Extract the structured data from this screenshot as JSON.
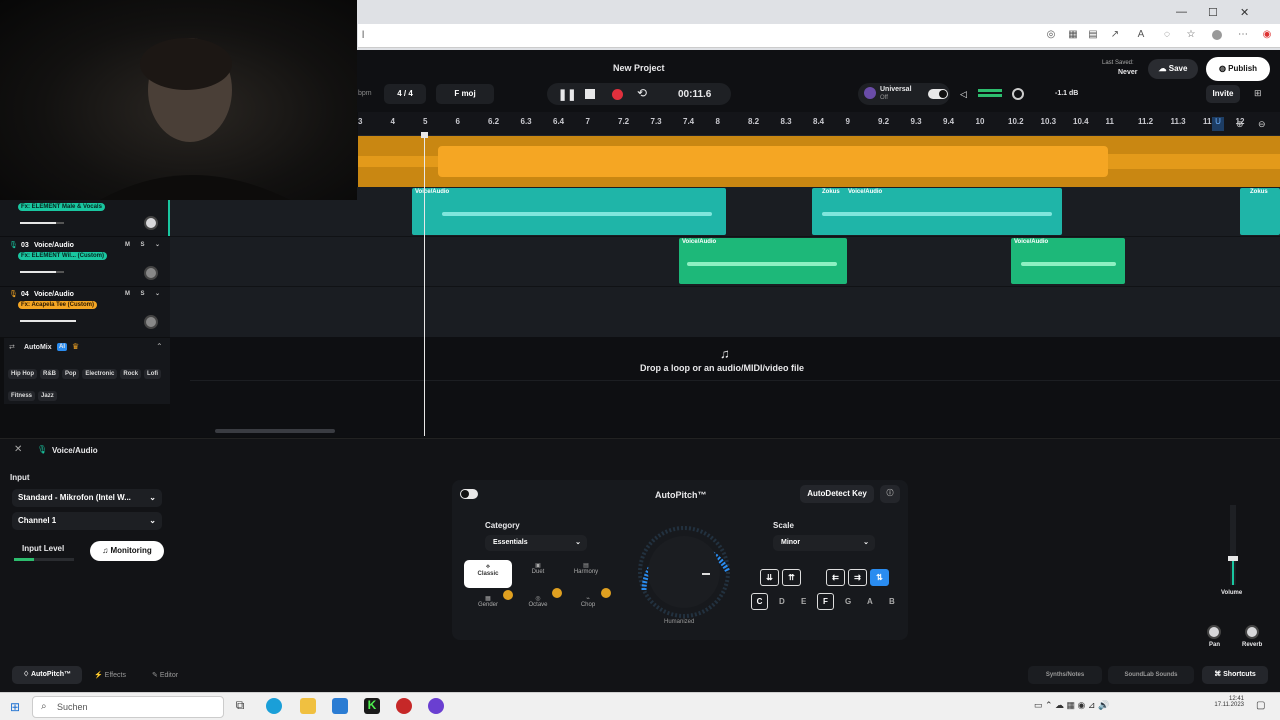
{
  "browser": {
    "address_fragment": "l",
    "icons": [
      "minimize-icon",
      "maximize-icon",
      "close-icon"
    ]
  },
  "header": {
    "project_title": "New Project",
    "last_saved_label": "Last Saved:",
    "last_saved_value": "Never",
    "save_label": "Save",
    "publish_label": "Publish",
    "invite_label": "Invite",
    "tempo_label": "bpm",
    "time_signature": "4 / 4",
    "key": "F moj",
    "time_display": "00:11.6",
    "universal_label": "Universal",
    "universal_sub": "Off",
    "db_readout": "-1.1 dB"
  },
  "ruler": {
    "ticks": [
      "3",
      "4",
      "5",
      "6",
      "6.2",
      "6.3",
      "6.4",
      "7",
      "7.2",
      "7.3",
      "7.4",
      "8",
      "8.2",
      "8.3",
      "8.4",
      "9",
      "9.2",
      "9.3",
      "9.4",
      "10",
      "10.2",
      "10.3",
      "10.4",
      "11",
      "11.2",
      "11.3",
      "11.4",
      "12"
    ]
  },
  "tracks": [
    {
      "number": "",
      "name": "",
      "tag": "Fx: ELEMENT Male & Vocals",
      "tag_color": "#19c6a0"
    },
    {
      "number": "03",
      "name": "Voice/Audio",
      "tag": "Fx: ELEMENT Wil... (Custom)",
      "tag_color": "#19c6a0"
    },
    {
      "number": "04",
      "name": "Voice/Audio",
      "tag": "Fx: Acapela Tee (Custom)",
      "tag_color": "#f5a623"
    }
  ],
  "clips": {
    "label": "Voice/Audio",
    "label_alt": "Zokus"
  },
  "automix": {
    "title": "AutoMix",
    "badge": "AI",
    "genres": [
      "Hip Hop",
      "R&B",
      "Pop",
      "Electronic",
      "Rock",
      "Lofi",
      "Fitness",
      "Jazz"
    ]
  },
  "dropzone": {
    "text": "Drop a loop or an audio/MIDI/video file"
  },
  "panel": {
    "track_name": "Voice/Audio",
    "input_title": "Input",
    "input_device": "Standard - Mikrofon (Intel W...",
    "channel": "Channel 1",
    "input_level_label": "Input Level",
    "monitoring_label": "Monitoring"
  },
  "autopitch": {
    "title": "AutoPitch™",
    "autodetect_label": "AutoDetect Key",
    "category_label": "Category",
    "category_value": "Essentials",
    "scale_label": "Scale",
    "scale_value": "Minor",
    "effects": [
      "Classic",
      "Duet",
      "Gender",
      "Harmony",
      "Chop",
      "Octave"
    ],
    "dial_label": "Humanized",
    "keys": [
      "C",
      "D",
      "E",
      "F",
      "G",
      "A",
      "B"
    ],
    "selected_keys": [
      "C",
      "F"
    ]
  },
  "mixer": {
    "volume_label": "Volume",
    "pan_label": "Pan",
    "reverb_label": "Reverb"
  },
  "footer": {
    "tab_autopitch": "AutoPitch™",
    "tab_effects": "Effects",
    "tab_editor": "Editor",
    "synths_label": "Synths/Notes",
    "soundlab_label": "SoundLab Sounds",
    "shortcuts_label": "Shortcuts"
  },
  "taskbar": {
    "search_placeholder": "Suchen",
    "time": "12:41",
    "date": "17.11.2023"
  },
  "colors": {
    "accent_teal": "#1fb5a8",
    "clip_green": "#1db879",
    "waveform_orange": "#f5a623",
    "record_red": "#e0303d",
    "toggle_blue": "#2a8cf0"
  }
}
